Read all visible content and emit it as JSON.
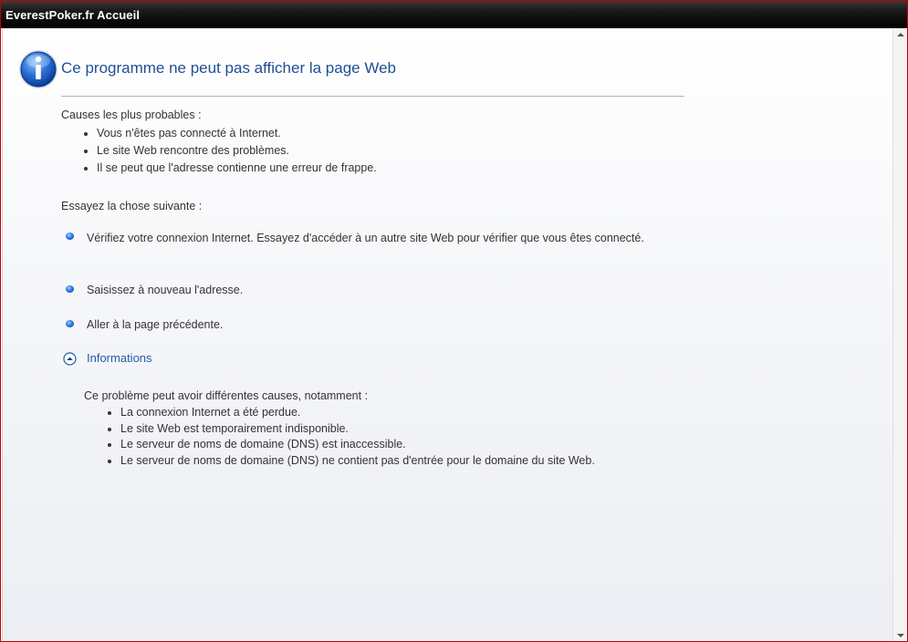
{
  "window": {
    "title": "EverestPoker.fr Accueil"
  },
  "page": {
    "title": "Ce programme ne peut pas afficher la page Web",
    "causes": {
      "heading": "Causes les plus probables :",
      "items": [
        "Vous n'êtes pas connecté à Internet.",
        "Le site Web rencontre des problèmes.",
        "Il se peut que l'adresse contienne une erreur de frappe."
      ]
    },
    "try": {
      "heading": "Essayez la chose suivante :",
      "actions": [
        "Vérifiez votre connexion Internet. Essayez d'accéder à un autre site Web pour vérifier que vous êtes connecté.",
        "Saisissez à nouveau l'adresse.",
        "Aller à la page précédente."
      ]
    },
    "info": {
      "toggle_label": "Informations",
      "intro": "Ce problème peut avoir différentes causes, notamment :",
      "items": [
        "La connexion Internet a été perdue.",
        "Le site Web est temporairement indisponible.",
        "Le serveur de noms de domaine (DNS) est inaccessible.",
        "Le serveur de noms de domaine (DNS) ne contient pas d'entrée pour le domaine du site Web."
      ]
    }
  },
  "colors": {
    "title": "#1f4e94",
    "link": "#1f5fa8",
    "frame": "#c00000"
  }
}
